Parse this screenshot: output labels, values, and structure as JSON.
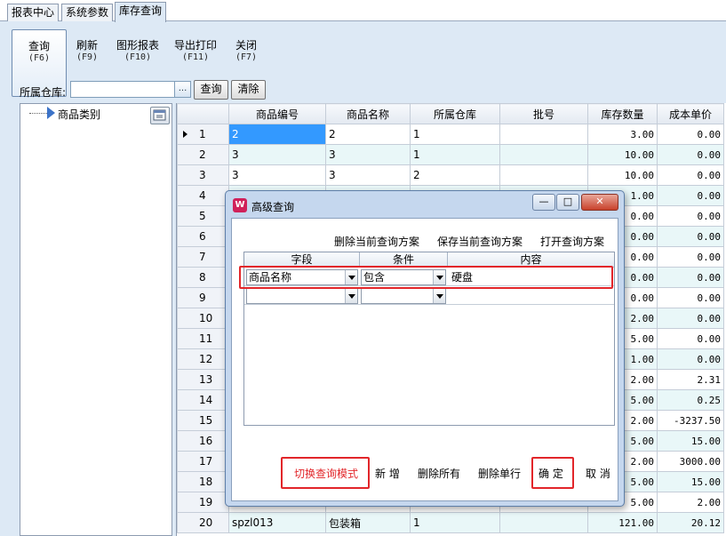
{
  "tabs": [
    "报表中心",
    "系统参数",
    "库存查询"
  ],
  "toolbar": [
    {
      "label": "查询",
      "key": "(F6)"
    },
    {
      "label": "刷新",
      "key": "(F9)"
    },
    {
      "label": "图形报表",
      "key": "(F10)"
    },
    {
      "label": "导出打印",
      "key": "(F11)"
    },
    {
      "label": "关闭",
      "key": "(F7)"
    }
  ],
  "filter": {
    "warehouse_label": "所属仓库:",
    "warehouse_value": "",
    "browse": "...",
    "query": "查询",
    "clear": "清除"
  },
  "tree": {
    "root": "商品类别"
  },
  "grid": {
    "columns": [
      "",
      "商品编号",
      "商品名称",
      "所属仓库",
      "批号",
      "库存数量",
      "成本单价"
    ],
    "rows": [
      [
        "1",
        "2",
        "2",
        "1",
        "",
        "3.00",
        "0.00"
      ],
      [
        "2",
        "3",
        "3",
        "1",
        "",
        "10.00",
        "0.00"
      ],
      [
        "3",
        "3",
        "3",
        "2",
        "",
        "10.00",
        "0.00"
      ],
      [
        "4",
        "",
        "",
        "",
        "",
        "1.00",
        "0.00"
      ],
      [
        "5",
        "",
        "",
        "",
        "",
        "0.00",
        "0.00"
      ],
      [
        "6",
        "",
        "",
        "",
        "",
        "0.00",
        "0.00"
      ],
      [
        "7",
        "",
        "",
        "",
        "",
        "0.00",
        "0.00"
      ],
      [
        "8",
        "",
        "",
        "",
        "",
        "0.00",
        "0.00"
      ],
      [
        "9",
        "",
        "",
        "",
        "",
        "0.00",
        "0.00"
      ],
      [
        "10",
        "",
        "",
        "",
        "",
        "2.00",
        "0.00"
      ],
      [
        "11",
        "",
        "",
        "",
        "",
        "5.00",
        "0.00"
      ],
      [
        "12",
        "",
        "",
        "",
        "",
        "1.00",
        "0.00"
      ],
      [
        "13",
        "",
        "",
        "",
        "",
        "2.00",
        "2.31"
      ],
      [
        "14",
        "",
        "",
        "",
        "",
        "5.00",
        "0.25"
      ],
      [
        "15",
        "",
        "",
        "",
        "",
        "2.00",
        "-3237.50"
      ],
      [
        "16",
        "",
        "",
        "",
        "",
        "5.00",
        "15.00"
      ],
      [
        "17",
        "",
        "",
        "",
        "",
        "2.00",
        "3000.00"
      ],
      [
        "18",
        "",
        "",
        "",
        "",
        "5.00",
        "15.00"
      ],
      [
        "19",
        "",
        "",
        "",
        "",
        "5.00",
        "2.00"
      ],
      [
        "20",
        "spzl013",
        "包装箱",
        "1",
        "",
        "121.00",
        "20.12"
      ]
    ]
  },
  "dialog": {
    "title": "高级查询",
    "window_buttons": [
      "—",
      "□",
      "✕"
    ],
    "top_links": [
      "删除当前查询方案",
      "保存当前查询方案",
      "打开查询方案"
    ],
    "headers": [
      "字段",
      "条件",
      "内容"
    ],
    "rows": [
      {
        "field": "商品名称",
        "condition": "包含",
        "content": "硬盘"
      },
      {
        "field": "",
        "condition": "",
        "content": ""
      }
    ],
    "bottom_buttons": [
      "切换查询模式",
      "新 增",
      "删除所有",
      "删除单行",
      "确 定",
      "取 消"
    ],
    "accent": "#e2262a"
  }
}
